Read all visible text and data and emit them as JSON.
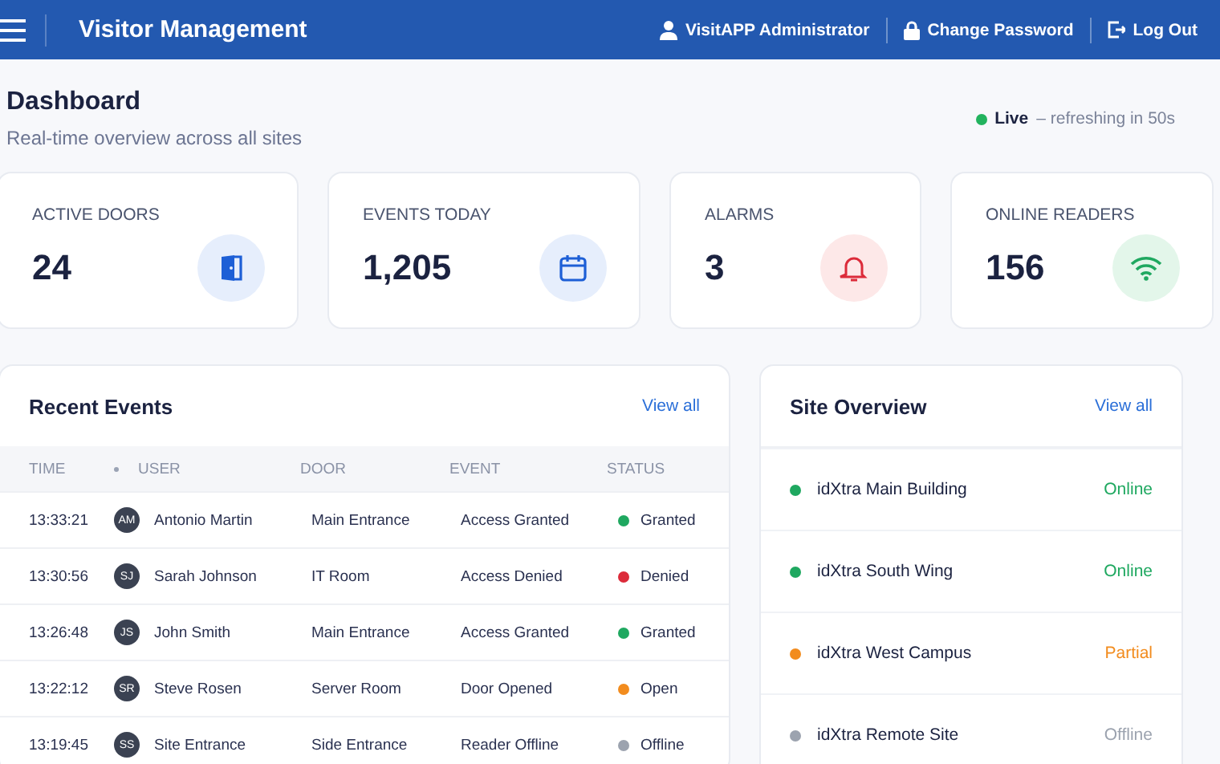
{
  "header": {
    "title": "Visitor Management",
    "user": "VisitAPP Administrator",
    "change_password": "Change Password",
    "logout": "Log Out"
  },
  "page": {
    "title": "Dashboard",
    "subtitle": "Real-time overview across all sites",
    "live_label": "Live",
    "live_text": "– refreshing in 50s"
  },
  "stats": [
    {
      "label": "ACTIVE DOORS",
      "value": "24",
      "kind": "door"
    },
    {
      "label": "EVENTS TODAY",
      "value": "1,205",
      "kind": "calendar"
    },
    {
      "label": "ALARMS",
      "value": "3",
      "kind": "bell"
    },
    {
      "label": "ONLINE READERS",
      "value": "156",
      "kind": "wifi"
    }
  ],
  "recent_events": {
    "title": "Recent Events",
    "view_all": "View all",
    "columns": [
      "TIME",
      "USER",
      "DOOR",
      "EVENT",
      "STATUS"
    ],
    "rows": [
      {
        "time": "13:33:21",
        "initials": "AM",
        "user": "Antonio Martin",
        "door": "Main Entrance",
        "event": "Access Granted",
        "status": "Granted",
        "color": "#1fa860"
      },
      {
        "time": "13:30:56",
        "initials": "SJ",
        "user": "Sarah Johnson",
        "door": "IT Room",
        "event": "Access Denied",
        "status": "Denied",
        "color": "#dc2b3a"
      },
      {
        "time": "13:26:48",
        "initials": "JS",
        "user": "John Smith",
        "door": "Main Entrance",
        "event": "Access Granted",
        "status": "Granted",
        "color": "#1fa860"
      },
      {
        "time": "13:22:12",
        "initials": "SR",
        "user": "Steve Rosen",
        "door": "Server Room",
        "event": "Door Opened",
        "status": "Open",
        "color": "#f28c1e"
      },
      {
        "time": "13:19:45",
        "initials": "SS",
        "user": "Site Entrance",
        "door": "Side Entrance",
        "event": "Reader Offline",
        "status": "Offline",
        "color": "#9ca3af"
      }
    ]
  },
  "site_overview": {
    "title": "Site Overview",
    "view_all": "View all",
    "sites": [
      {
        "name": "idXtra Main Building",
        "status": "Online",
        "color": "#1fa860"
      },
      {
        "name": "idXtra South Wing",
        "status": "Online",
        "color": "#1fa860"
      },
      {
        "name": "idXtra West Campus",
        "status": "Partial",
        "color": "#f28c1e"
      },
      {
        "name": "idXtra Remote Site",
        "status": "Offline",
        "color": "#9ca3af"
      }
    ]
  }
}
